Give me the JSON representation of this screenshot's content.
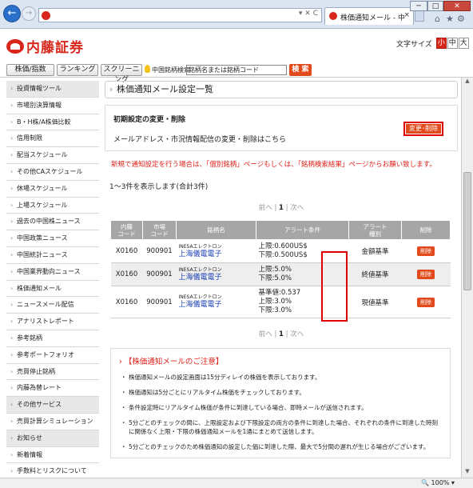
{
  "browser": {
    "tab_title": "株価通知メール - 中国...",
    "tab_close": "×",
    "back_glyph": "←",
    "forward_glyph": "→",
    "window_min": "─",
    "window_max": "□",
    "window_close": "✕",
    "toolbar_icons": [
      "⌂",
      "★",
      "⚙"
    ],
    "address_controls": "▾ ✕ C",
    "zoom": "100%"
  },
  "header": {
    "logo_text": "内藤証券",
    "font_size_label": "文字サイズ",
    "font_sizes": [
      "小",
      "中",
      "大"
    ],
    "brand_color": "#d8261b"
  },
  "toolbar": {
    "btn_index": "株価/指数",
    "btn_ranking": "ランキング",
    "btn_screening": "スクリーニング",
    "search_label": "中国銘柄検索",
    "search_value": "銘柄名または銘柄コード",
    "search_button": "検 索"
  },
  "sidebar": {
    "items": [
      {
        "label": "投資情報ツール",
        "header": true
      },
      {
        "label": "市場別決算情報"
      },
      {
        "label": "B・H株/A株価比較"
      },
      {
        "label": "信用制限"
      },
      {
        "label": "配当スケジュール"
      },
      {
        "label": "その他CAスケジュール"
      },
      {
        "label": "休場スケジュール"
      },
      {
        "label": "上場スケジュール"
      },
      {
        "label": "過去の中国株ニュース"
      },
      {
        "label": "中国政策ニュース"
      },
      {
        "label": "中国統計ニュース"
      },
      {
        "label": "中国業界動向ニュース"
      },
      {
        "label": "株価通知メール"
      },
      {
        "label": "ニュースメール配信"
      },
      {
        "label": "アナリストレポート"
      },
      {
        "label": "参考銘柄"
      },
      {
        "label": "参考ポートフォリオ"
      },
      {
        "label": "売買停止銘柄"
      },
      {
        "label": "内藤為替レート"
      },
      {
        "label": "その他サービス",
        "header": true
      },
      {
        "label": "売買計算シミュレーション"
      },
      {
        "label": "お知らせ",
        "header": true
      },
      {
        "label": "新着情報"
      },
      {
        "label": "手数料とリスクについて"
      }
    ]
  },
  "main": {
    "page_title": "株価通知メール設定一覧",
    "settings_heading": "初期設定の変更・削除",
    "settings_desc": "メールアドレス・市況情報配信の変更・削除はこちら",
    "change_button": "変更･削除",
    "notice": "新規で通知設定を行う場合は、「個別銘柄」ページもしくは、「銘柄検索結果」ページからお願い致します。",
    "count_text": "1〜3件を表示します(合計3件)",
    "pager_prev": "前へ",
    "pager_current": "1",
    "pager_next": "次へ",
    "pager_sep": "|",
    "table": {
      "headers": [
        "内藤\nコード",
        "市場\nコード",
        "銘柄名",
        "アラート条件",
        "アラート\n種別",
        "削除"
      ],
      "rows": [
        {
          "naito": "X0160",
          "market": "900901",
          "name_en": "INESAエレクトロン",
          "name_jp": "上海儀電電子",
          "cond1": "上限:0.600US$",
          "cond2": "下限:0.500US$",
          "cond3": "",
          "type": "金額基準",
          "delete": "削除"
        },
        {
          "naito": "X0160",
          "market": "900901",
          "name_en": "INESAエレクトロン",
          "name_jp": "上海儀電電子",
          "cond1": "上限:5.0%",
          "cond2": "下限:5.0%",
          "cond3": "",
          "type": "終値基準",
          "delete": "削除"
        },
        {
          "naito": "X0160",
          "market": "900901",
          "name_en": "INESAエレクトロン",
          "name_jp": "上海儀電電子",
          "cond1": "基準値:0.537",
          "cond2": "上限:3.0%",
          "cond3": "下限:3.0%",
          "type": "現値基準",
          "delete": "削除"
        }
      ]
    },
    "caution": {
      "heading": "【株価通知メールのご注意】",
      "items": [
        "株価通知メールの設定画面は15分ディレイの株価を表示しております。",
        "株価通知は5分ごとにリアルタイム株価をチェックしております。",
        "条件設定時にリアルタイム株価が条件に到達している場合、即時メールが送信されます。",
        "5分ごとのチェックの間に、上限設定および下限設定の両方の条件に到達した場合、それぞれの条件に到達した時刻に関係なく上限・下限の株価通知メールを1通にまとめて送信します。",
        "5分ごとのチェックのため株価通知の設定した価に到達した際、最大で5分間の遅れが生じる場合がございます。"
      ]
    }
  }
}
